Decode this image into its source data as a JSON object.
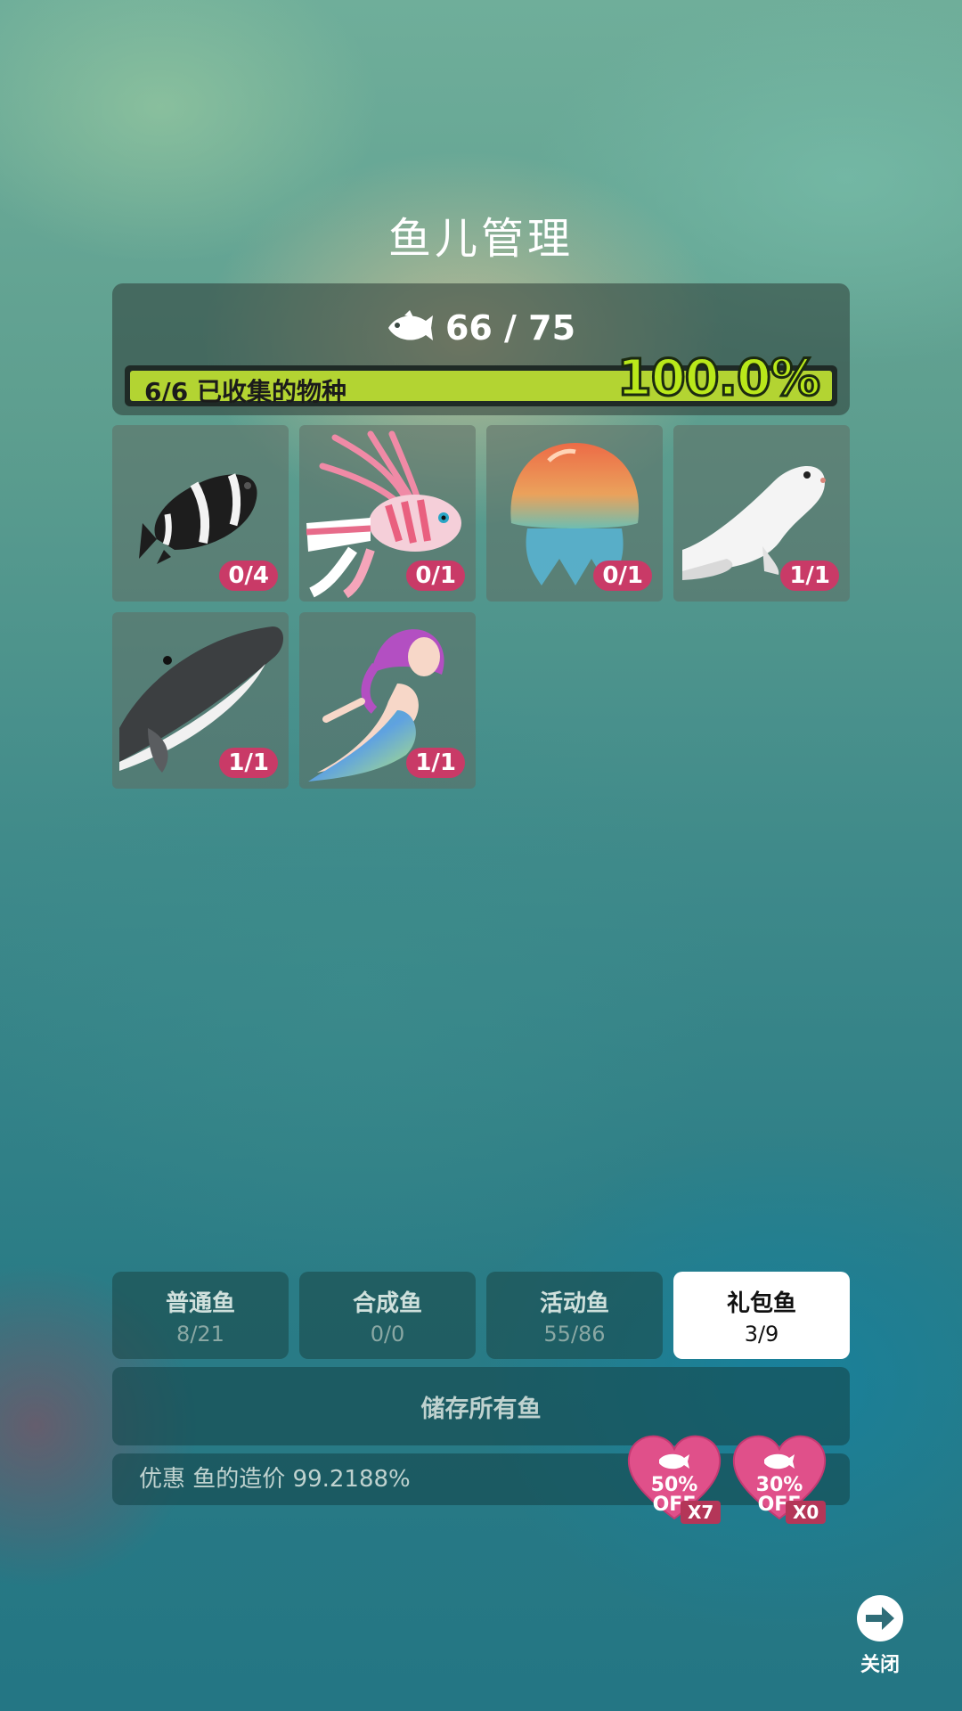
{
  "title": "鱼儿管理",
  "summary": {
    "fish_count": "66 / 75",
    "progress_label": "6/6 已收集的物种",
    "progress_percent": "100.0%",
    "progress_fraction": 1.0
  },
  "fish": [
    {
      "name": "clownfish",
      "count": "0/4"
    },
    {
      "name": "lionfish",
      "count": "0/1"
    },
    {
      "name": "jellyfish",
      "count": "0/1"
    },
    {
      "name": "seal",
      "count": "1/1"
    },
    {
      "name": "humpback-whale",
      "count": "1/1"
    },
    {
      "name": "mermaid",
      "count": "1/1"
    }
  ],
  "tabs": [
    {
      "label": "普通鱼",
      "count": "8/21",
      "active": false
    },
    {
      "label": "合成鱼",
      "count": "0/0",
      "active": false
    },
    {
      "label": "活动鱼",
      "count": "55/86",
      "active": false
    },
    {
      "label": "礼包鱼",
      "count": "3/9",
      "active": true
    }
  ],
  "store_button": "储存所有鱼",
  "discount": {
    "text": "优惠 鱼的造价 99.2188%",
    "coupons": [
      {
        "percent": "50%",
        "off": "OFF",
        "multiplier": "X7"
      },
      {
        "percent": "30%",
        "off": "OFF",
        "multiplier": "X0"
      }
    ]
  },
  "close_label": "关闭",
  "colors": {
    "badge": "#c93a67",
    "progress": "#b3d432",
    "heart": "#e0508a"
  }
}
